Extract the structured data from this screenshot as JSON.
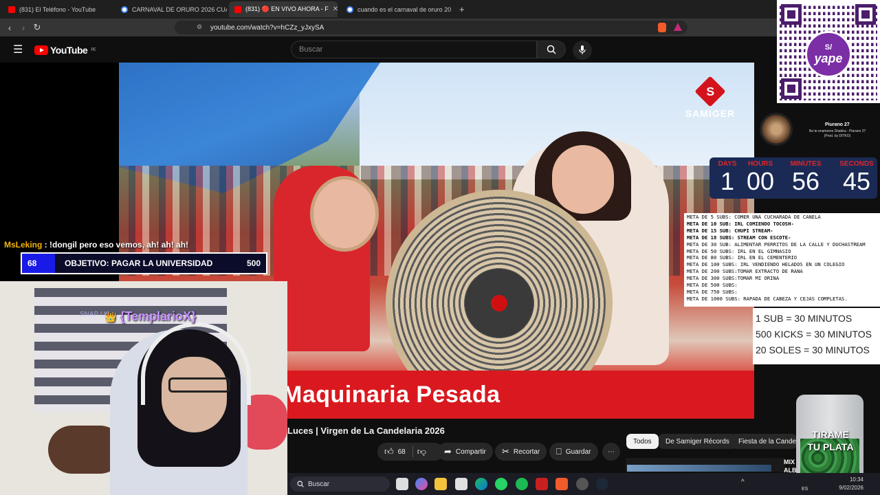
{
  "tabs": [
    {
      "title": "(831) El Teléfono - YouTube"
    },
    {
      "title": "CARNAVAL DE ORURO 2026 CUAND"
    },
    {
      "title": "(831) 🔴 EN VIVO AHORA - F",
      "close": "✕"
    },
    {
      "title": "cuando es el carnaval de oruro 2026"
    }
  ],
  "new_tab": "+",
  "address": {
    "url": "youtube.com/watch?v=hCZz_yJxySA"
  },
  "youtube": {
    "logo_text": "YouTube",
    "region": "PE",
    "search_placeholder": "Buscar"
  },
  "video": {
    "brand": "SAMIGER",
    "brand_letter": "S",
    "banner_text": "Maquinaria Pesada",
    "title": "Luces | Virgen de La Candelaria 2026",
    "likes": "68",
    "share_label": "Compartir",
    "clip_label": "Recortar",
    "save_label": "Guardar",
    "more": "⋯"
  },
  "chips": [
    "Todos",
    "De Samiger Récords",
    "Fiesta de la Candela"
  ],
  "recommended": {
    "label_1": "MIX",
    "label_2": "ALB"
  },
  "chat": {
    "user": "MsLeking",
    "message": " : !dongil pero eso vemos, ah! ah! ah!"
  },
  "goal": {
    "current": "68",
    "label": "OBJETIVO: PAGAR LA UNIVERSIDAD",
    "target": "500",
    "progress_fraction": 0.136
  },
  "alert": {
    "prefix": "SNAP US",
    "name": "{TemplarioX}"
  },
  "yape": {
    "symbol": "S/",
    "word": "yape"
  },
  "now_playing": {
    "artist": "Piurano 27",
    "line1": "No te enamores Shakira - Piurano 27",
    "line2": "(Prod. by DITKO)"
  },
  "timer": {
    "labels": [
      "DAYS",
      "HOURS",
      "MINUTES",
      "SECONDS"
    ],
    "values": [
      "1",
      "00",
      "56",
      "45"
    ]
  },
  "metas": [
    {
      "text": "META DE 5 SUBS: COMER UNA CUCHARADA DE CANELA",
      "bold": false
    },
    {
      "text": "META DE 10 SUB: IRL COMIENDO TOCOSH-",
      "bold": true
    },
    {
      "text": "META DE 15 SUB: CHUPI STREAM-",
      "bold": true
    },
    {
      "text": "META DE 18 SUBS: STREAM CON ESCOTE-",
      "bold": true
    },
    {
      "text": "META DE 30 SUB:  ALIMENTAR PERRITOS DE LA CALLE Y DUCHASTREAM",
      "bold": false
    },
    {
      "text": "META DE 50 SUBS: IRL EN EL GIMNASIO",
      "bold": false
    },
    {
      "text": "META DE 80 SUBS: IRL EN EL CEMENTERIO",
      "bold": false
    },
    {
      "text": "META DE 100 SUBS: IRL VENDIENDO HELADOS EN UN COLEGIO",
      "bold": false
    },
    {
      "text": "META DE 200 SUBS:TOMAR EXTRACTO DE RANA",
      "bold": false
    },
    {
      "text": "META DE 300 SUBS:TOMAR MI ORINA",
      "bold": false
    },
    {
      "text": "META DE 500 SUBS:",
      "bold": false
    },
    {
      "text": "META DE 750 SUBS:",
      "bold": false
    },
    {
      "text": "META DE 1000 SUBS: RAPADA DE CABEZA Y CEJAS COMPLETAS.",
      "bold": false
    }
  ],
  "rates": [
    "1 SUB = 30 MINUTOS",
    "500 KICKS = 30 MINUTOS",
    "20 SOLES = 30 MINUTOS"
  ],
  "jar": {
    "line1": "TIRAME",
    "line2": "TU PLATA"
  },
  "taskbar": {
    "search": "Buscar",
    "lang": "ES",
    "time": "10:34",
    "date": "9/02/2026"
  }
}
